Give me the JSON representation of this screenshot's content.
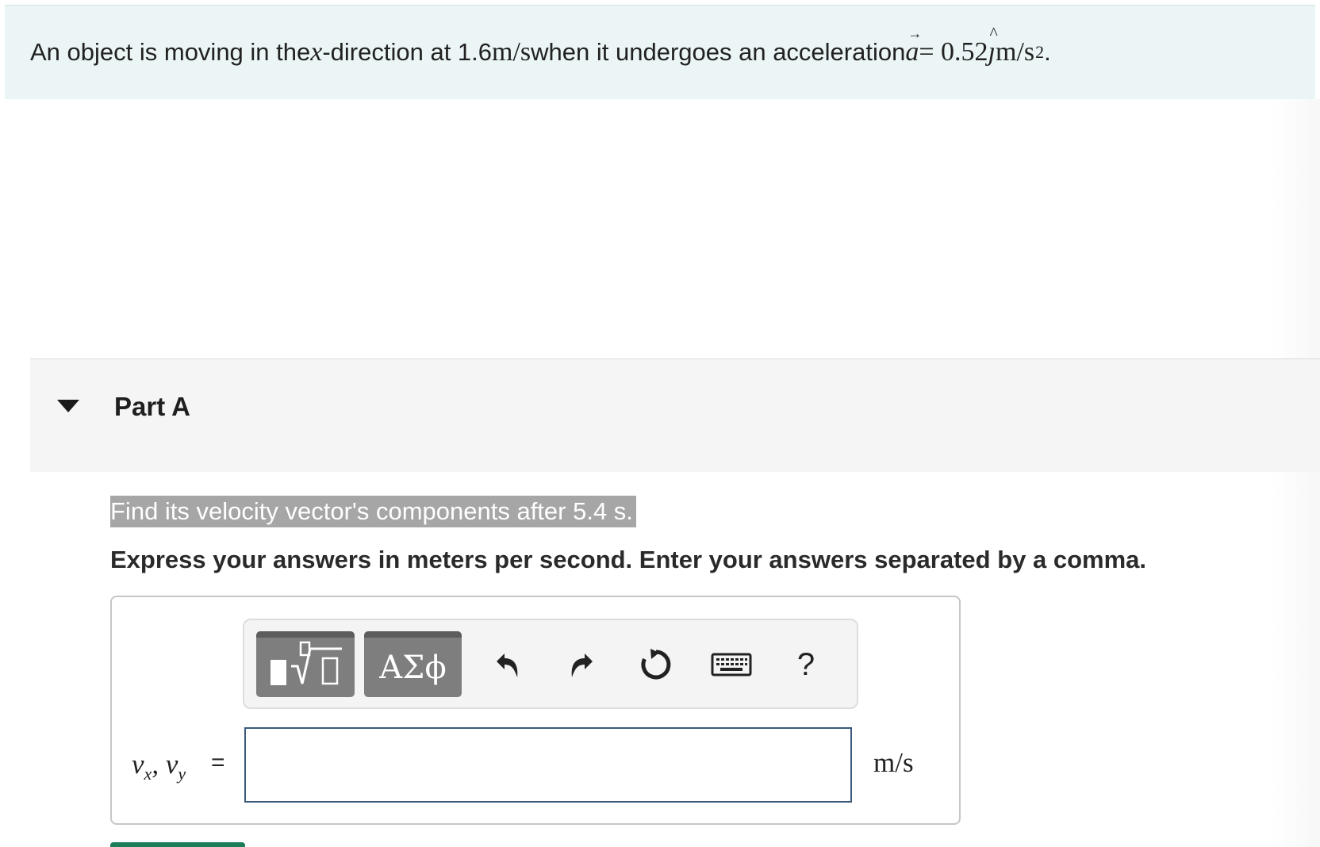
{
  "problem": {
    "intro_text_1": "An object is moving in the ",
    "x_var": "x",
    "intro_text_2": "-direction at 1.6 ",
    "speed_unit": "m/s",
    "intro_text_3": " when it undergoes an acceleration ",
    "accel_symbol": "a",
    "vec_arrow": "→",
    "equals": " = 0.52",
    "j_unit_vector": "ȷ",
    "hat": "^",
    "accel_unit": " m/s",
    "accel_exp": "2",
    "period": "."
  },
  "part": {
    "title": "Part A",
    "question": "Find its velocity vector's components after 5.4 s.",
    "instruction": "Express your answers in meters per second. Enter your answers separated by a comma."
  },
  "toolbar": {
    "templates_icon": "templates-icon",
    "greek_label": "ΑΣϕ",
    "undo_icon": "undo-icon",
    "redo_icon": "redo-icon",
    "reset_icon": "reset-icon",
    "keyboard_icon": "keyboard-icon",
    "help_label": "?"
  },
  "answer": {
    "label_vx": "v",
    "label_vx_sub": "x",
    "label_sep": ", ",
    "label_vy": "v",
    "label_vy_sub": "y",
    "eq": "=",
    "value": "",
    "unit": "m/s"
  },
  "colors": {
    "intro_bg": "#ebf5f5",
    "part_header_bg": "#f5f5f5",
    "selection_bg": "#a6a6a6",
    "button_bg": "#7e7e7e",
    "input_border": "#3a5a7a",
    "submit": "#1c7d5a"
  }
}
